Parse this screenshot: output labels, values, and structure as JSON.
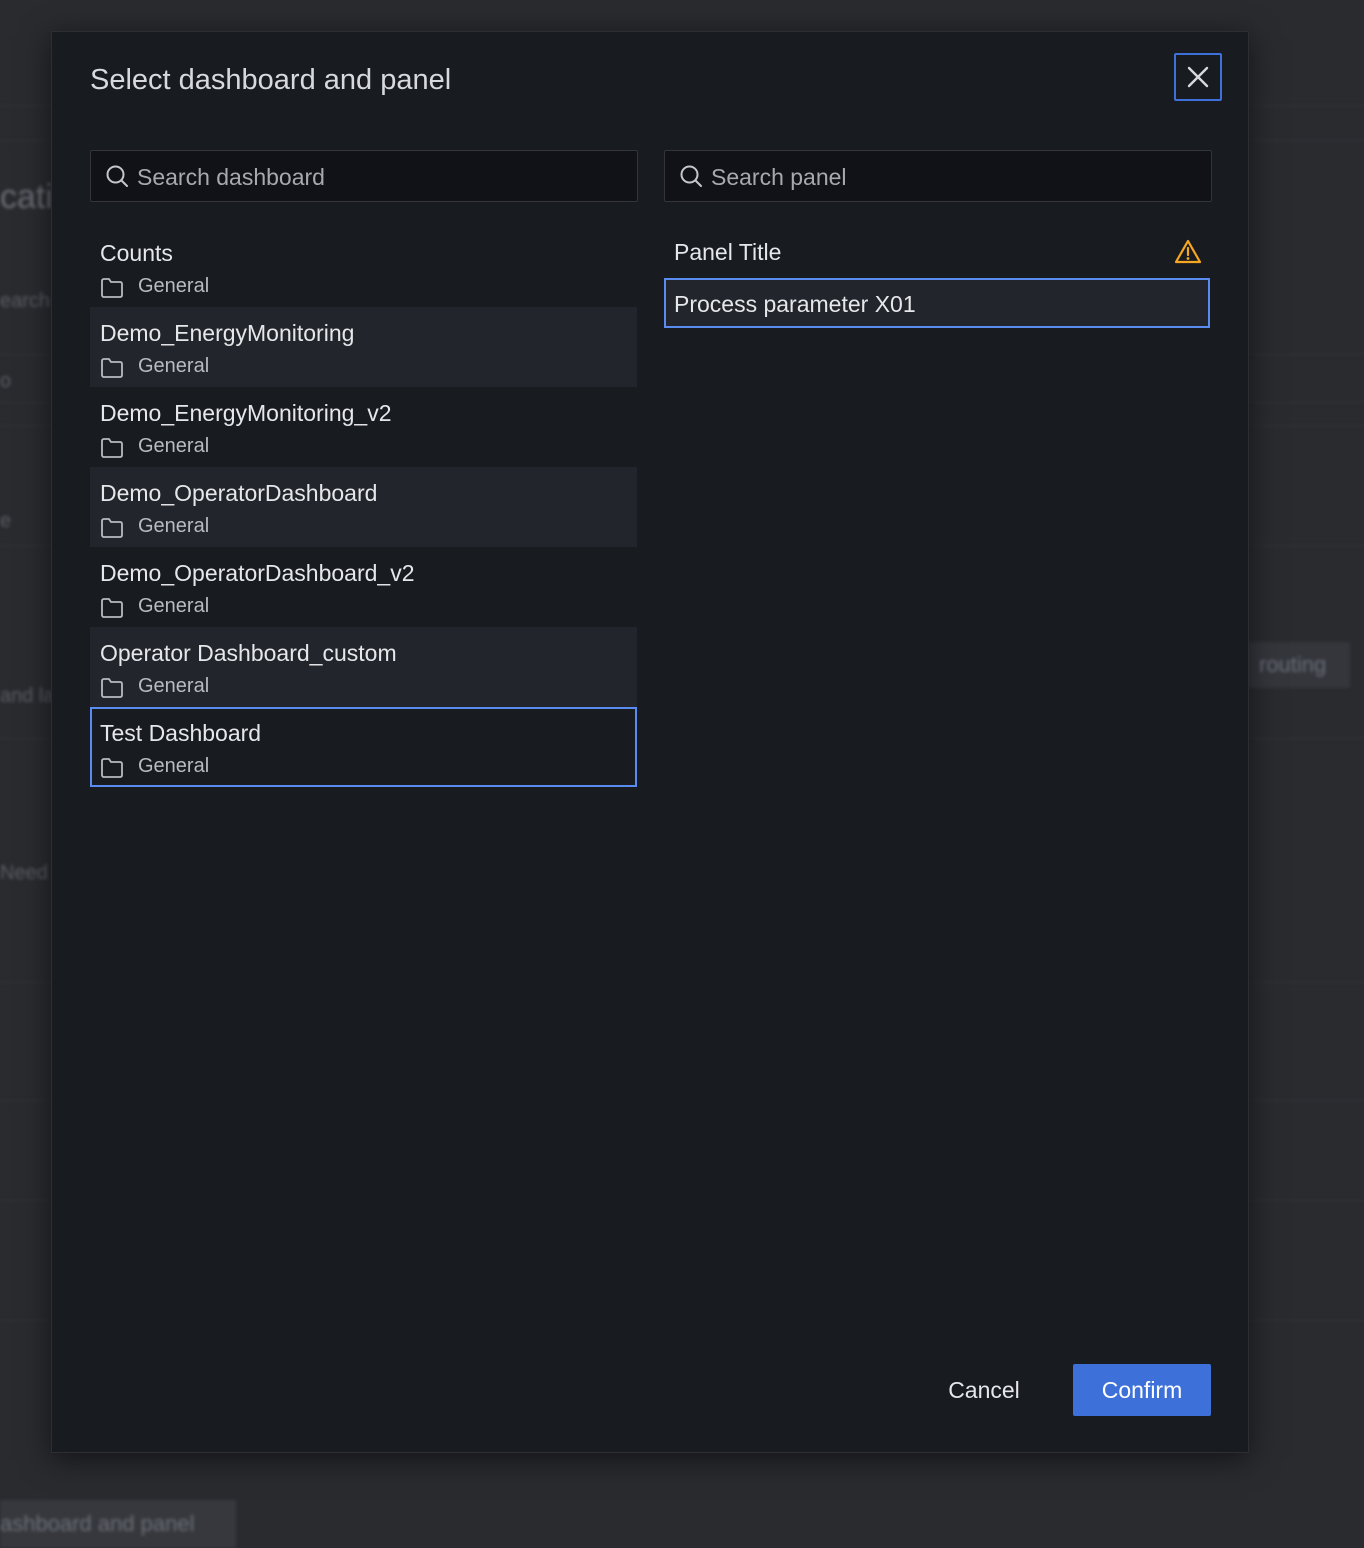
{
  "background": {
    "fragments": [
      "cati",
      "earch",
      "o",
      "e",
      "and la",
      "Need",
      "routing",
      "ashboard and panel"
    ]
  },
  "modal": {
    "title": "Select dashboard and panel",
    "dashboard_search": {
      "placeholder": "Search dashboard",
      "value": ""
    },
    "panel_search": {
      "placeholder": "Search panel",
      "value": ""
    },
    "dashboards": [
      {
        "title": "Counts",
        "folder": "General"
      },
      {
        "title": "Demo_EnergyMonitoring",
        "folder": "General"
      },
      {
        "title": "Demo_EnergyMonitoring_v2",
        "folder": "General"
      },
      {
        "title": "Demo_OperatorDashboard",
        "folder": "General"
      },
      {
        "title": "Demo_OperatorDashboard_v2",
        "folder": "General"
      },
      {
        "title": "Operator Dashboard_custom",
        "folder": "General"
      },
      {
        "title": "Test Dashboard",
        "folder": "General",
        "selected": true
      }
    ],
    "panels": {
      "header": "Panel Title",
      "items": [
        {
          "title": "Process parameter X01",
          "selected": true
        }
      ]
    },
    "buttons": {
      "cancel": "Cancel",
      "confirm": "Confirm"
    }
  },
  "colors": {
    "accent": "#3d71d9",
    "selection_border": "#5a8cf0",
    "warning": "#f5a623",
    "modal_bg": "#181b1f"
  }
}
